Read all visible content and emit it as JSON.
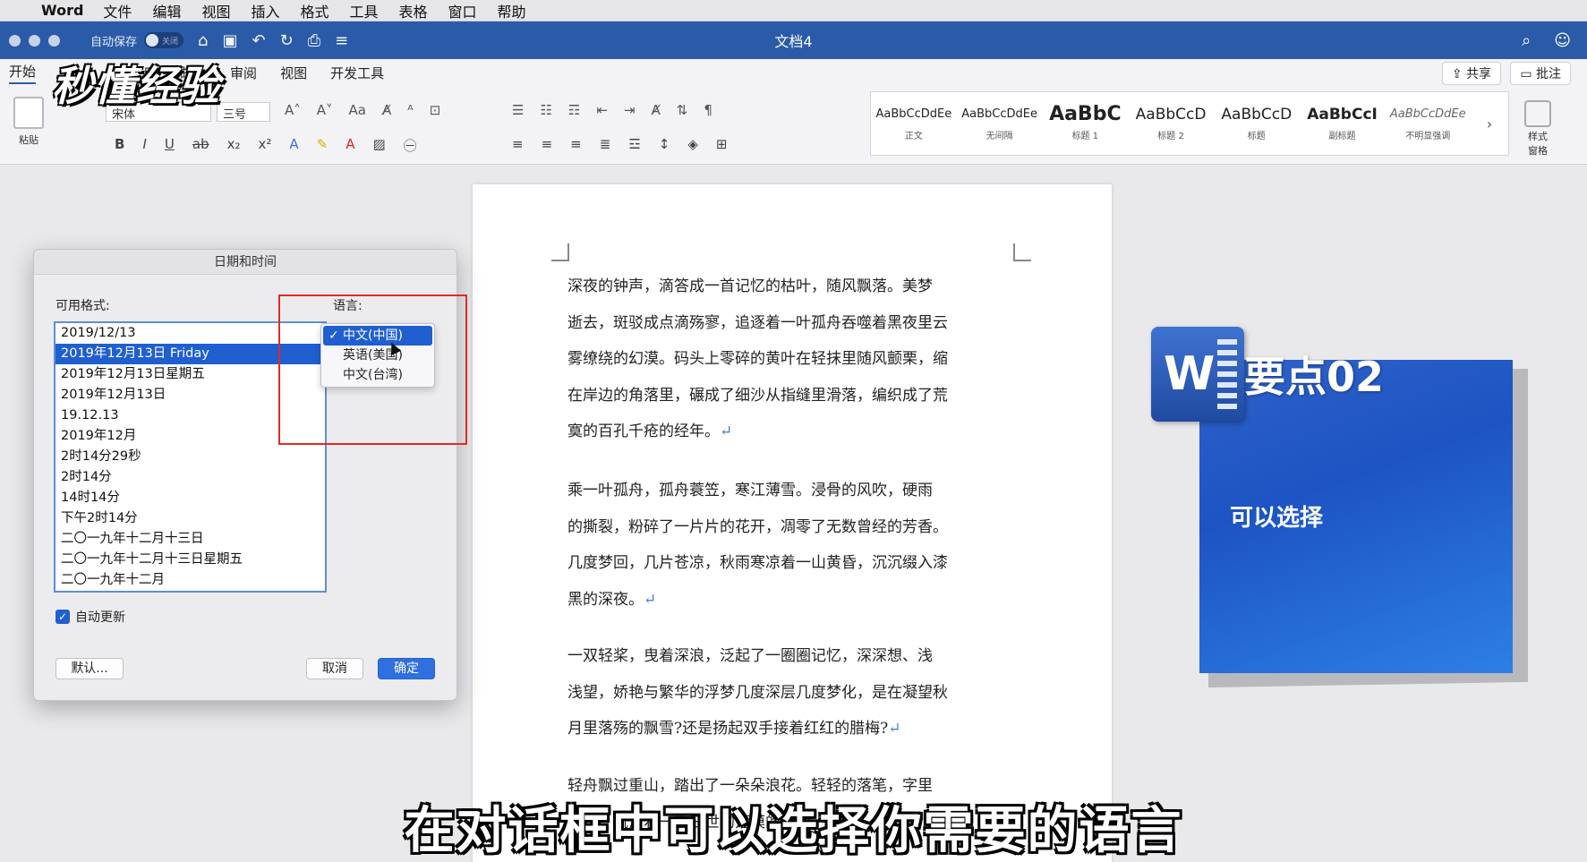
{
  "menubar": {
    "app": "Word",
    "items": [
      "文件",
      "编辑",
      "视图",
      "插入",
      "格式",
      "工具",
      "表格",
      "窗口",
      "帮助"
    ]
  },
  "titlebar": {
    "autosave_label": "自动保存",
    "autosave_state": "关闭",
    "document_title": "文档4"
  },
  "ribbon": {
    "tabs": [
      "开始",
      "用",
      "邮件",
      "审阅",
      "视图",
      "开发工具"
    ],
    "share_label": "共享",
    "comment_label": "批注",
    "paste_label": "粘贴",
    "font_name": "宋体",
    "font_size": "三号",
    "styles": [
      {
        "preview": "AaBbCcDdEe",
        "name": "正文"
      },
      {
        "preview": "AaBbCcDdEe",
        "name": "无间隔"
      },
      {
        "preview": "AaBbC",
        "name": "标题 1"
      },
      {
        "preview": "AaBbCcD",
        "name": "标题 2"
      },
      {
        "preview": "AaBbCcD",
        "name": "标题"
      },
      {
        "preview": "AaBbCcI",
        "name": "副标题"
      },
      {
        "preview": "AaBbCcDdEe",
        "name": "不明显强调"
      }
    ],
    "style_pane_label": "样式\n窗格"
  },
  "watermark": {
    "logo_text": "秒懂经验"
  },
  "dialog": {
    "title": "日期和时间",
    "formats_label": "可用格式:",
    "language_label": "语言:",
    "formats": [
      "2019/12/13",
      "2019年12月13日 Friday",
      "2019年12月13日星期五",
      "2019年12月13日",
      "19.12.13",
      "2019年12月",
      "2时14分29秒",
      "2时14分",
      "14时14分",
      "下午2时14分",
      "二〇一九年十二月十三日",
      "二〇一九年十二月十三日星期五",
      "二〇一九年十二月"
    ],
    "selected_format_index": 1,
    "languages": [
      "中文(中国)",
      "英语(美国)",
      "中文(台湾)"
    ],
    "selected_language_index": 0,
    "auto_update_label": "自动更新",
    "auto_update_checked": true,
    "default_button": "默认...",
    "cancel_button": "取消",
    "ok_button": "确定"
  },
  "document": {
    "paragraphs": [
      [
        "深夜的钟声，滴答成一首记忆的枯叶，随风飘落。美梦",
        "逝去，斑驳成点滴殇寥，追逐着一叶孤舟吞噬着黑夜里云",
        "雾缭绕的幻漠。码头上零碎的黄叶在轻抹里随风颤栗，缩",
        "在岸边的角落里，碾成了细沙从指缝里滑落，编织成了荒",
        "寞的百孔千疮的经年。"
      ],
      [
        "乘一叶孤舟，孤舟蓑笠，寒江薄雪。浸骨的风吹，硬雨",
        "的撕裂，粉碎了一片片的花开，凋零了无数曾经的芳香。",
        "几度梦回，几片苍凉，秋雨寒凉着一山黄昏，沉沉缀入漆",
        "黑的深夜。"
      ],
      [
        "一双轻桨，曳着深浪，泛起了一圈圈记忆，深深想、浅",
        "浅望，娇艳与繁华的浮梦几度深层几度梦化，是在凝望秋",
        "月里落殇的飘雪?还是扬起双手接着红红的腊梅?"
      ],
      [
        "轻舟飘过重山，踏出了一朵朵浪花。轻轻的落笔，字里",
        "传说，流淌着一生三世的落漠的瞬间。"
      ]
    ]
  },
  "overlay_card": {
    "icon_letter": "W",
    "title": "要点02",
    "subtitle": "可以选择"
  },
  "caption": "在对话框中可以选择你需要的语言",
  "colors": {
    "title_bar": "#2b5ba8",
    "selection": "#1f5fd0",
    "highlight_box": "#e02a2a"
  }
}
